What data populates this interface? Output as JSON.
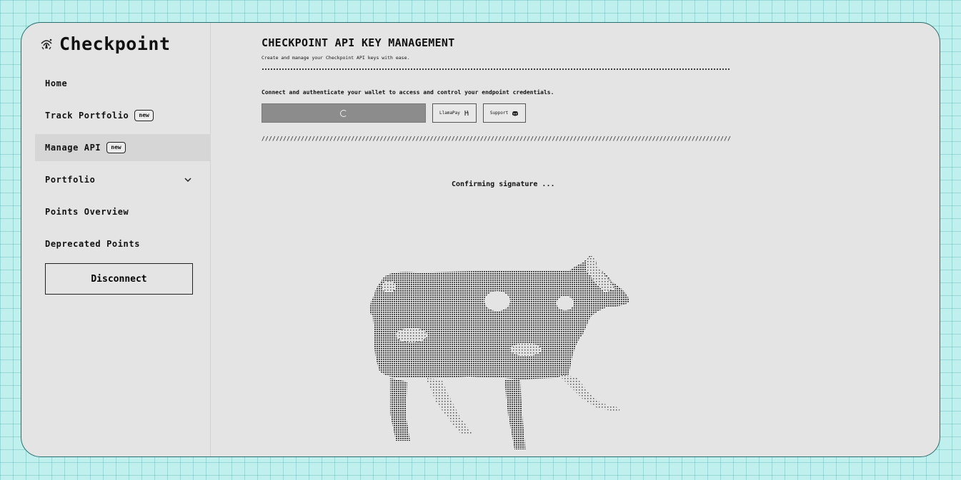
{
  "sidebar": {
    "brand": "Checkpoint",
    "brand_icon": "fingerprint-logo-icon",
    "items": [
      {
        "label": "Home"
      },
      {
        "label": "Track Portfolio",
        "badge": "new"
      },
      {
        "label": "Manage API",
        "badge": "new",
        "active": true
      },
      {
        "label": "Portfolio",
        "icon": "chevron-down-icon"
      },
      {
        "label": "Points Overview"
      },
      {
        "label": "Deprecated Points"
      }
    ],
    "disconnect_label": "Disconnect"
  },
  "main": {
    "title": "CHECKPOINT API KEY MANAGEMENT",
    "subtitle": "Create and manage your Checkpoint API keys with ease.",
    "description": "Connect and authenticate your wallet to access and control your endpoint credentials.",
    "connect_button": {
      "state": "loading",
      "icon": "spinner-icon"
    },
    "llamapay_label": "LlamaPay",
    "llamapay_icon": "llama-icon",
    "support_label": "Support",
    "support_icon": "discord-icon",
    "status_text": "Confirming signature ...",
    "illustration": "ascii-cow-illustration",
    "divider_slashes": "///////////////////////////////////////////////////////////////////////////////////////////////////////////////////////////////////////////////////////////"
  },
  "colors": {
    "background": "#bff0ee",
    "panel": "#e4e4e4",
    "active_item": "#d6d6d6",
    "connect_button": "#8c8c8c",
    "window_border": "#2a6f6f"
  }
}
